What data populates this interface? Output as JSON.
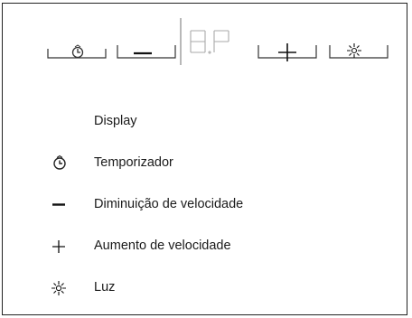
{
  "panel": {
    "display_readout": "8.8"
  },
  "legend": [
    {
      "icon": "",
      "label": "Display"
    },
    {
      "icon": "timer-icon",
      "label": "Temporizador"
    },
    {
      "icon": "minus-icon",
      "label": "Diminuição de velocidade"
    },
    {
      "icon": "plus-icon",
      "label": "Aumento de velocidade"
    },
    {
      "icon": "light-icon",
      "label": "Luz"
    }
  ]
}
